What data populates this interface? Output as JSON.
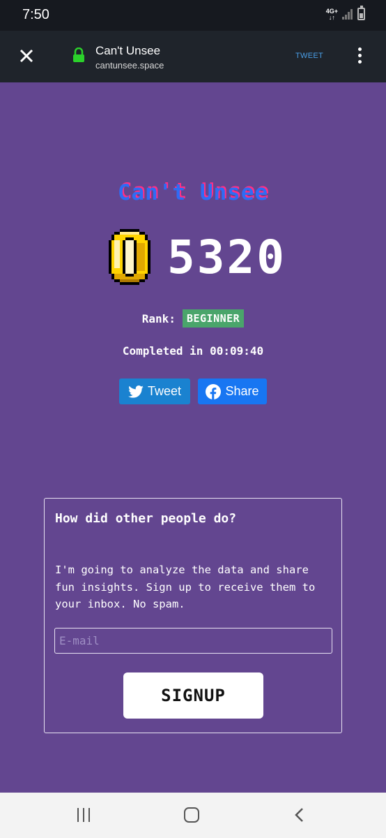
{
  "status_bar": {
    "time": "7:50",
    "network_label": "4G+",
    "icons": [
      "data-arrows-icon",
      "signal-icon",
      "battery-icon"
    ]
  },
  "browser": {
    "close_icon": "close-icon",
    "lock_icon": "lock-icon",
    "title": "Can't Unsee",
    "url": "cantunsee.space",
    "tweet_label": "TWEET",
    "menu_icon": "more-vert-icon",
    "colors": {
      "lock": "#2bd12b",
      "tweet_link": "#4a9fe8"
    }
  },
  "main": {
    "game_title": "Can't Unsee",
    "coin_icon": "coin-icon",
    "score": "5320",
    "rank_label": "Rank:",
    "rank_value": "BEGINNER",
    "completed_text": "Completed in 00:09:40",
    "tweet_button": "Tweet",
    "share_button": "Share",
    "colors": {
      "background": "#634690",
      "title_blue": "#2e6cf5",
      "title_pink": "#ff2f86",
      "rank_badge": "#4aa56b",
      "tweet_btn": "#1a82d0",
      "share_btn": "#1876f2"
    }
  },
  "signup": {
    "title": "How did other people do?",
    "body": "I'm going to analyze the data and share fun insights. Sign up to receive them to your inbox. No spam.",
    "email_placeholder": "E-mail",
    "email_value": "",
    "button_label": "SIGNUP"
  },
  "nav_bar": {
    "icons": [
      "recents-icon",
      "home-icon",
      "back-icon"
    ]
  }
}
